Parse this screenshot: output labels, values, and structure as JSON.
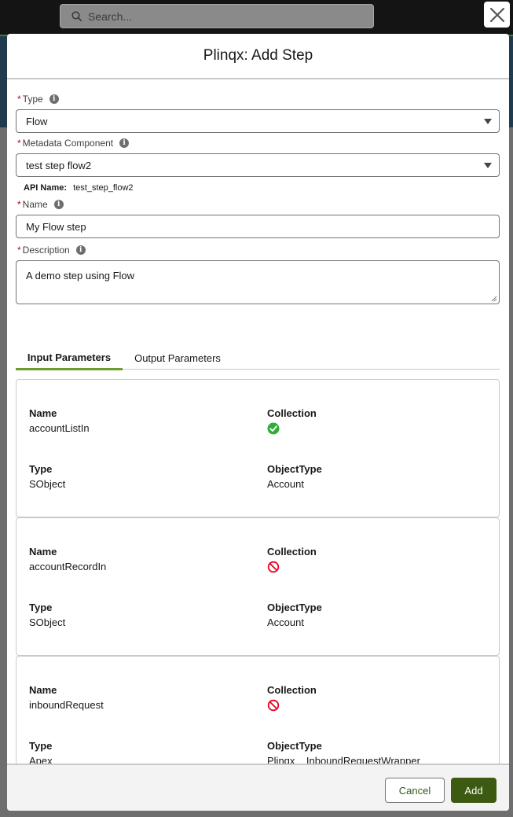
{
  "topbar": {
    "search_placeholder": "Search..."
  },
  "modal": {
    "title": "Plinqx: Add Step",
    "fields": {
      "type": {
        "label": "Type",
        "required_mark": "*",
        "value": "Flow"
      },
      "metadata_component": {
        "label": "Metadata Component",
        "required_mark": "*",
        "value": "test step flow2"
      },
      "api_name": {
        "label": "API Name:",
        "value": "test_step_flow2"
      },
      "name": {
        "label": "Name",
        "required_mark": "*",
        "value": "My Flow step"
      },
      "description": {
        "label": "Description",
        "required_mark": "*",
        "value": "A demo step using Flow"
      }
    },
    "tabs": [
      {
        "label": "Input Parameters",
        "active": true
      },
      {
        "label": "Output Parameters",
        "active": false
      }
    ],
    "param_labels": {
      "name": "Name",
      "collection": "Collection",
      "type": "Type",
      "object_type": "ObjectType"
    },
    "parameters": [
      {
        "name": "accountListIn",
        "collection": true,
        "collection_icon": "check-circle-icon",
        "type": "SObject",
        "object_type": "Account"
      },
      {
        "name": "accountRecordIn",
        "collection": false,
        "collection_icon": "ban-icon",
        "type": "SObject",
        "object_type": "Account"
      },
      {
        "name": "inboundRequest",
        "collection": false,
        "collection_icon": "ban-icon",
        "type": "Apex",
        "object_type": "Plinqx__InboundRequestWrapper"
      }
    ],
    "footer": {
      "cancel_label": "Cancel",
      "add_label": "Add"
    }
  },
  "colors": {
    "accent_green": "#3d5a13",
    "tab_underline": "#6b9c2e",
    "check_green": "#2e844a",
    "ban_red": "#ea001e",
    "required_red": "#ba0517"
  }
}
